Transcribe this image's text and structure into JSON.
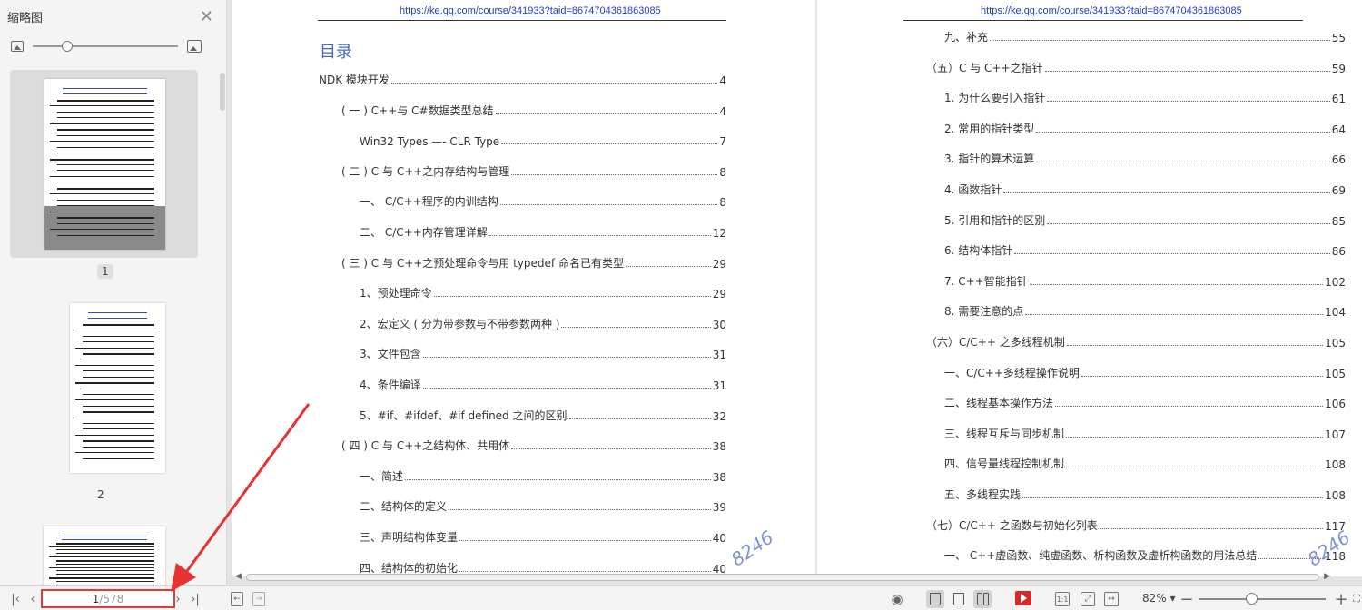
{
  "sidebar": {
    "title": "缩略图",
    "close_icon": "close-icon",
    "thumbnails": [
      {
        "label": "1",
        "selected": true
      },
      {
        "label": "2",
        "selected": false
      },
      {
        "label": "",
        "selected": false
      }
    ]
  },
  "document": {
    "header_url": "https://ke.qq.com/course/341933?taid=8674704361863085",
    "toc_title": "目录",
    "watermark": "8246",
    "left_page_toc": [
      {
        "text": "NDK 模块开发",
        "page": "4",
        "level": 0
      },
      {
        "text": "( 一 ) C++与 C#数据类型总结",
        "page": "4",
        "level": 1
      },
      {
        "text": "Win32 Types —- CLR Type",
        "page": "7",
        "level": 2
      },
      {
        "text": "( 二 ) C 与 C++之内存结构与管理",
        "page": "8",
        "level": 1
      },
      {
        "text": "一、      C/C++程序的内训结构",
        "page": "8",
        "level": 2
      },
      {
        "text": "二、      C/C++内存管理详解",
        "page": "12",
        "level": 2
      },
      {
        "text": "( 三 ) C 与 C++之预处理命令与用 typedef 命名已有类型",
        "page": "29",
        "level": 1
      },
      {
        "text": "1、预处理命令",
        "page": "29",
        "level": 2
      },
      {
        "text": "2、宏定义 ( 分为带参数与不带参数两种 )",
        "page": "30",
        "level": 2
      },
      {
        "text": "3、文件包含",
        "page": "31",
        "level": 2
      },
      {
        "text": "4、条件编译",
        "page": "31",
        "level": 2
      },
      {
        "text": "5、#if、#ifdef、#if defined 之间的区别",
        "page": "32",
        "level": 2
      },
      {
        "text": "( 四 ) C 与 C++之结构体、共用体",
        "page": "38",
        "level": 1
      },
      {
        "text": "一、简述",
        "page": "38",
        "level": 2
      },
      {
        "text": "二、结构体的定义",
        "page": "39",
        "level": 2
      },
      {
        "text": "三、声明结构体变量",
        "page": "40",
        "level": 2
      },
      {
        "text": "四、结构体的初始化",
        "page": "40",
        "level": 2
      }
    ],
    "right_page_toc": [
      {
        "text": "九、补充",
        "page": "55",
        "level": 2
      },
      {
        "text": "（五）C 与 C++之指针",
        "page": "59",
        "level": 1
      },
      {
        "text": "1. 为什么要引入指针",
        "page": "61",
        "level": 2
      },
      {
        "text": "2. 常用的指针类型",
        "page": "64",
        "level": 2
      },
      {
        "text": "3. 指针的算术运算",
        "page": "66",
        "level": 2
      },
      {
        "text": "4. 函数指针",
        "page": "69",
        "level": 2
      },
      {
        "text": "5. 引用和指针的区别",
        "page": "85",
        "level": 2
      },
      {
        "text": "6. 结构体指针",
        "page": "86",
        "level": 2
      },
      {
        "text": "7. C++智能指针",
        "page": "102",
        "level": 2
      },
      {
        "text": "8. 需要注意的点",
        "page": "104",
        "level": 2
      },
      {
        "text": "（六）C/C++ 之多线程机制",
        "page": "105",
        "level": 1
      },
      {
        "text": "一、C/C++多线程操作说明",
        "page": "105",
        "level": 2
      },
      {
        "text": "二、线程基本操作方法",
        "page": "106",
        "level": 2
      },
      {
        "text": "三、线程互斥与同步机制",
        "page": "107",
        "level": 2
      },
      {
        "text": "四、信号量线程控制机制",
        "page": "108",
        "level": 2
      },
      {
        "text": "五、多线程实践",
        "page": "108",
        "level": 2
      },
      {
        "text": "（七）C/C++ 之函数与初始化列表",
        "page": "117",
        "level": 1
      },
      {
        "text": "一、  C++虚函数、纯虚函数、析构函数及虚析构函数的用法总结",
        "page": "118",
        "level": 2
      }
    ]
  },
  "statusbar": {
    "current_page": "1",
    "total_pages": "/578",
    "zoom": "82%",
    "zoom_level_fraction": 0.4,
    "icons": [
      "first-page-icon",
      "prev-page-icon",
      "next-page-icon",
      "last-page-icon",
      "back-icon",
      "forward-icon",
      "eye-icon",
      "continuous-view-icon",
      "single-page-icon",
      "double-page-icon",
      "play-icon",
      "actual-size-icon",
      "fit-page-icon",
      "fit-width-icon",
      "zoom-out-icon",
      "zoom-in-icon",
      "fullscreen-icon"
    ]
  }
}
